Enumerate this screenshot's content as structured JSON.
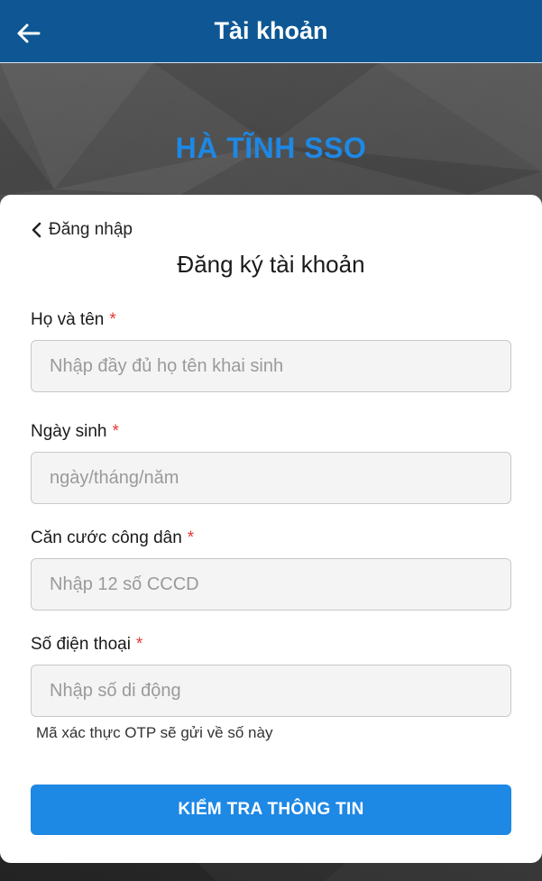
{
  "header": {
    "title": "Tài khoản",
    "back_icon": "arrow-left-icon"
  },
  "banner": {
    "title": "HÀ TĨNH SSO"
  },
  "form": {
    "back_link": "Đăng nhập",
    "title": "Đăng ký tài khoản",
    "required_mark": "*",
    "fields": [
      {
        "label": "Họ và tên",
        "placeholder": "Nhập đầy đủ họ tên khai sinh",
        "value": ""
      },
      {
        "label": "Ngày sinh",
        "placeholder": "ngày/tháng/năm",
        "value": ""
      },
      {
        "label": "Căn cước công dân",
        "placeholder": "Nhập 12 số CCCD",
        "value": ""
      },
      {
        "label": "Số điện thoại",
        "placeholder": "Nhập số di động",
        "value": ""
      }
    ],
    "otp_hint": "Mã xác thực OTP sẽ gửi về số này",
    "submit_label": "KIỂM TRA THÔNG TIN"
  },
  "colors": {
    "header_bg": "#0e5794",
    "accent": "#1e88e5",
    "required": "#e53935"
  }
}
